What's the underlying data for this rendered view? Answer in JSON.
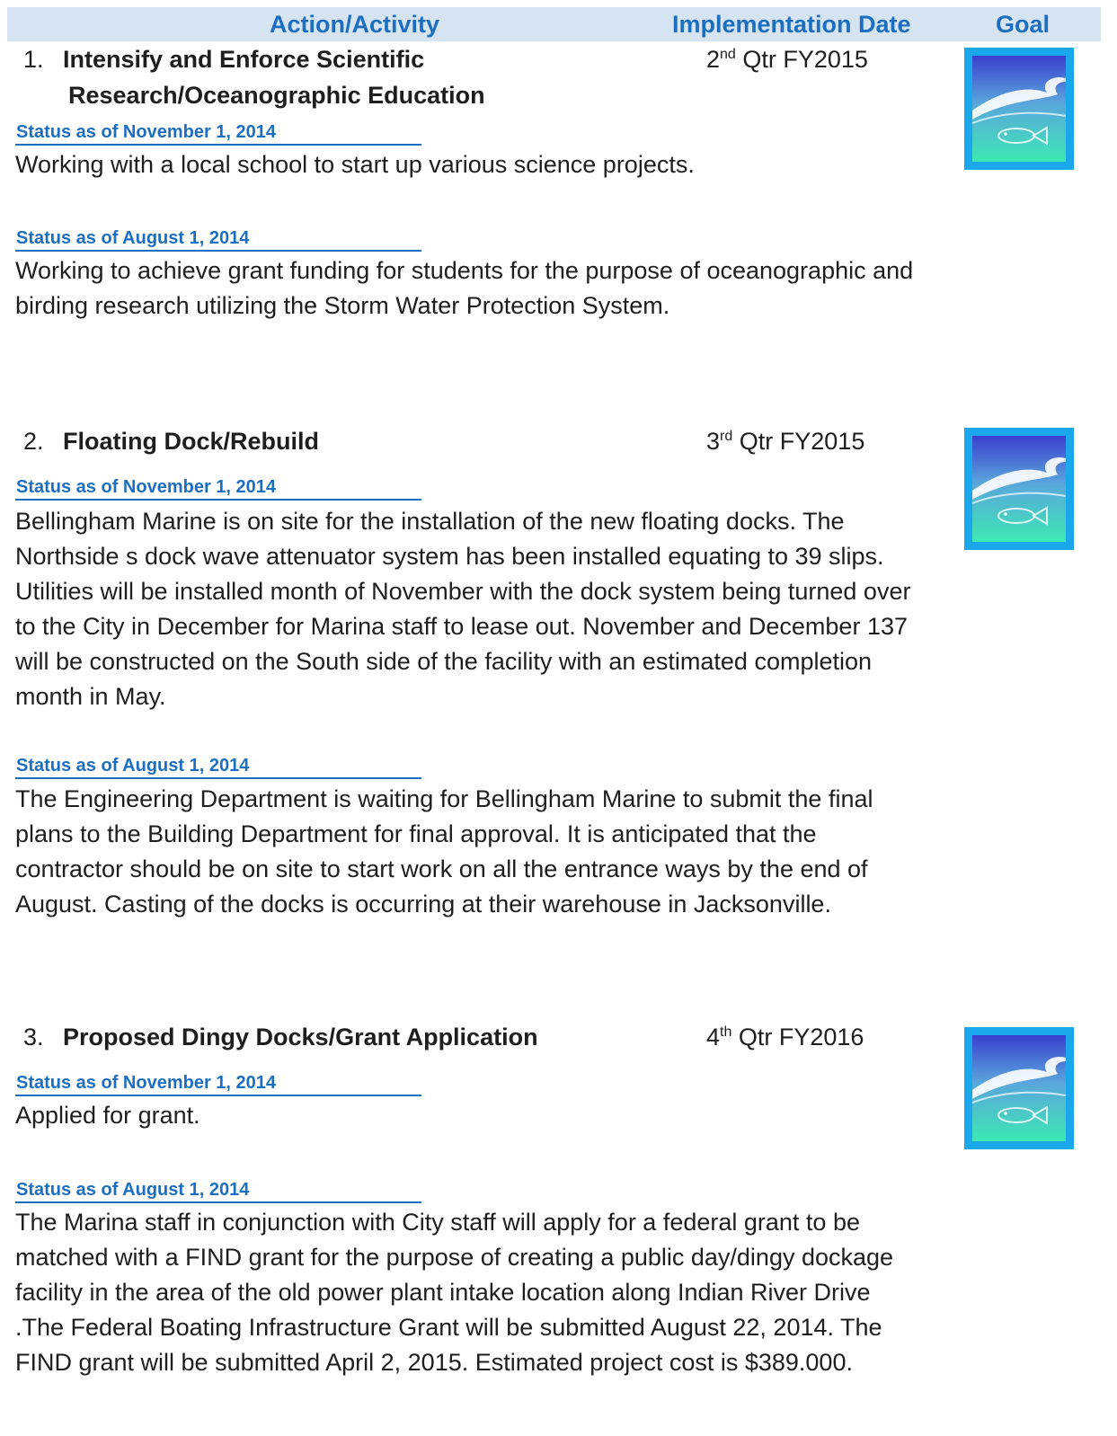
{
  "header": {
    "action_label": "Action/Activity",
    "date_label": "Implementation Date",
    "goal_label": "Goal"
  },
  "goal_icon": {
    "name": "wave-fish-icon",
    "colors": {
      "frame": "#1aa7ec",
      "sky_top": "#3a3fcf",
      "water_bottom": "#3de8b4",
      "wave": "#ffffff"
    }
  },
  "items": [
    {
      "number": "1.",
      "title_line1": "Intensify and Enforce Scientific",
      "title_line2": "Research/Oceanographic Education",
      "date_prefix": "2",
      "date_sup": "nd",
      "date_suffix": " Qtr FY2015",
      "statuses": [
        {
          "label": "Status as of November 1, 2014",
          "text": "Working with a local school to start up various science projects."
        },
        {
          "label": "Status as of August 1, 2014",
          "text": "Working to achieve grant funding for students for the purpose of oceanographic and birding research utilizing the Storm Water Protection System."
        }
      ]
    },
    {
      "number": "2.",
      "title_line1": "Floating Dock/Rebuild",
      "date_prefix": "3",
      "date_sup": "rd",
      "date_suffix": " Qtr FY2015",
      "statuses": [
        {
          "label": "Status as of November 1, 2014",
          "text": " Bellingham Marine is on site for the installation of the new floating docks. The Northside s dock wave attenuator system has been installed equating to 39 slips. Utilities will be installed month of November with the dock system being   turned over to the City in December for Marina staff to lease out. November and December 137 will be constructed on the South side of the facility with an estimated completion month in May."
        },
        {
          "label": "Status as of August 1, 2014",
          "text": "The Engineering Department is waiting for Bellingham Marine to submit the final plans to the Building Department for final approval. It is anticipated that the contractor should be on site to start work on all the entrance ways by the end of August.  Casting of the docks is occurring at their warehouse in Jacksonville."
        }
      ]
    },
    {
      "number": "3.",
      "title_line1": "Proposed Dingy Docks/Grant Application",
      "date_prefix": "4",
      "date_sup": "th",
      "date_suffix": " Qtr FY2016",
      "statuses": [
        {
          "label": "Status as of November 1, 2014",
          "text": "Applied for grant."
        },
        {
          "label": "Status as of August 1, 2014",
          "text": "The Marina staff in conjunction with City staff will apply for a federal grant to be matched with a FIND grant for the purpose of creating a public day/dingy dockage facility in the area of the old power plant intake location along Indian River Drive .The Federal Boating Infrastructure Grant will be submitted August 22, 2014.  The FIND grant will be submitted April 2, 2015.  Estimated project cost  is $389.000."
        }
      ]
    }
  ]
}
